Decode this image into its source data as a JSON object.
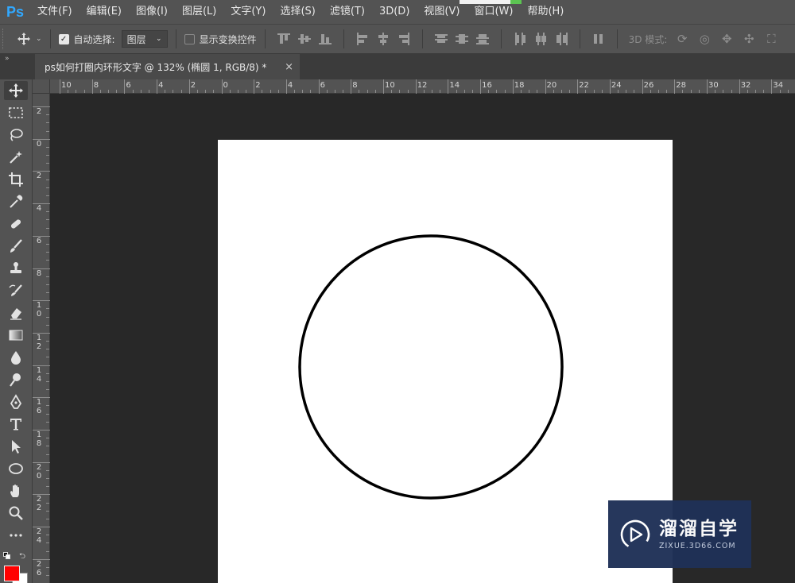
{
  "app": {
    "logo": "Ps",
    "menu": [
      "文件(F)",
      "编辑(E)",
      "图像(I)",
      "图层(L)",
      "文字(Y)",
      "选择(S)",
      "滤镜(T)",
      "3D(D)",
      "视图(V)",
      "窗口(W)",
      "帮助(H)"
    ]
  },
  "options": {
    "auto_select_label": "自动选择:",
    "auto_select_checked": true,
    "layer_dropdown_value": "图层",
    "show_transform_label": "显示变换控件",
    "mode_label": "3D 模式:"
  },
  "tab": {
    "title": "ps如何打圈内环形文字 @ 132% (椭圆 1, RGB/8) *",
    "close": "×"
  },
  "ruler": {
    "horizontal_labels": [
      "10",
      "8",
      "6",
      "4",
      "2",
      "0",
      "2",
      "4",
      "6",
      "8",
      "10",
      "12",
      "14",
      "16",
      "18",
      "20",
      "22",
      "24",
      "26",
      "28",
      "30",
      "32",
      "34"
    ],
    "vertical_labels": [
      "2",
      "0",
      "2",
      "4",
      "6",
      "8",
      "10",
      "12",
      "14",
      "16",
      "18",
      "20",
      "22",
      "24",
      "26"
    ]
  },
  "colors": {
    "foreground": "#ff0000",
    "background": "#ffffff"
  },
  "watermark": {
    "title": "溜溜自学",
    "subtitle": "ZIXUE.3D66.COM"
  }
}
